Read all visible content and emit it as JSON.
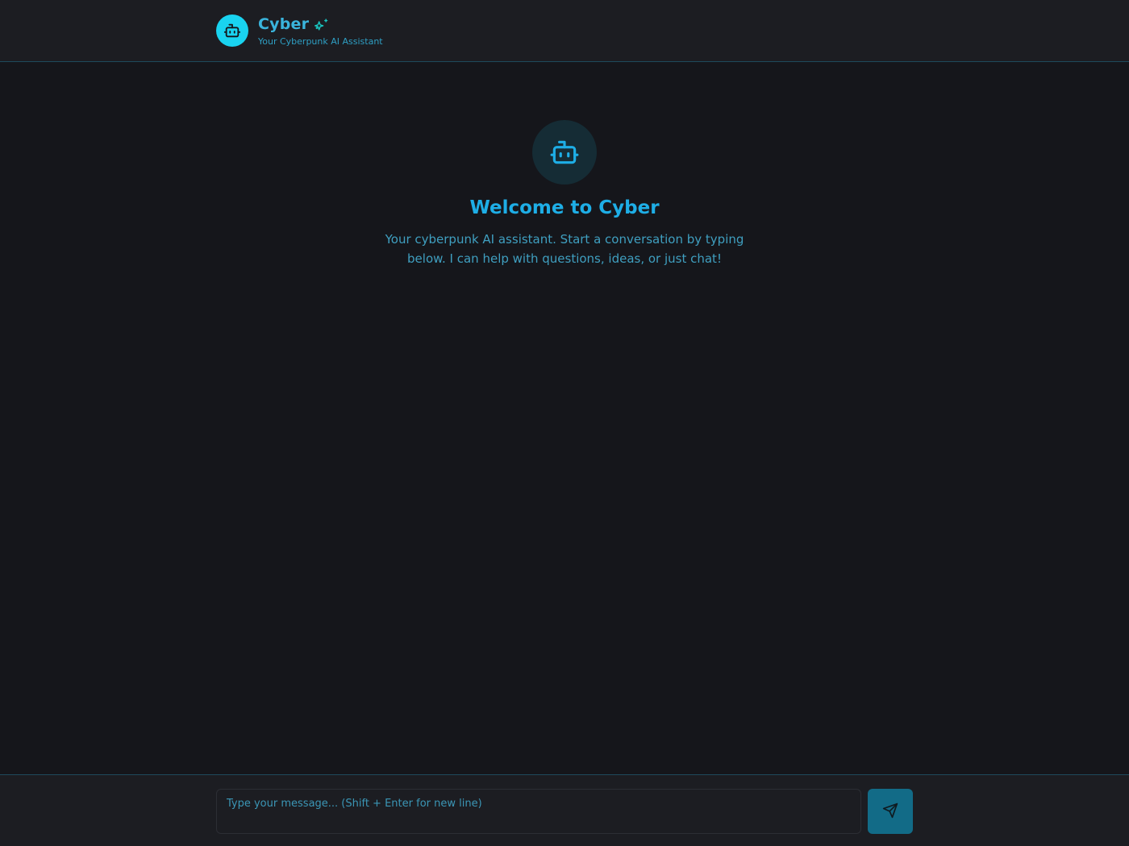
{
  "header": {
    "title": "Cyber",
    "subtitle": "Your Cyberpunk AI Assistant",
    "logo_icon": "bot-icon",
    "title_icon": "sparkles-icon"
  },
  "welcome": {
    "icon": "bot-icon",
    "title": "Welcome to Cyber",
    "text": "Your cyberpunk AI assistant. Start a conversation by typing below. I can help with questions, ideas, or just chat!"
  },
  "composer": {
    "placeholder": "Type your message... (Shift + Enter for new line)",
    "value": "",
    "send_icon": "send-icon"
  },
  "colors": {
    "accent": "#19d3f0",
    "title": "#1eaee6",
    "background": "#15161b",
    "panel": "#1c1d22",
    "send_button": "#126b87"
  }
}
